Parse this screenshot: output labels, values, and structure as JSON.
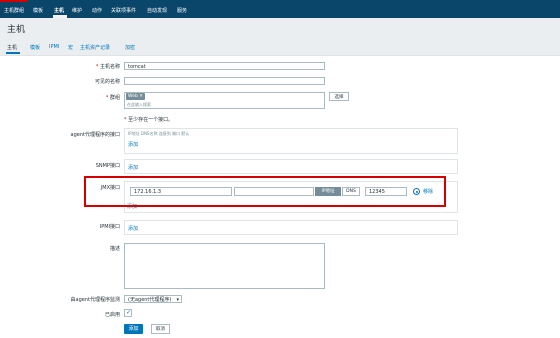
{
  "nav": {
    "items": [
      {
        "label": "主机群组"
      },
      {
        "label": "模板"
      },
      {
        "label": "主机"
      },
      {
        "label": "维护"
      },
      {
        "label": "动作"
      },
      {
        "label": "关联项事件"
      },
      {
        "label": "自动发现"
      },
      {
        "label": "服务"
      }
    ]
  },
  "page": {
    "title": "主机"
  },
  "tabs": [
    {
      "label": "主机"
    },
    {
      "label": "模板"
    },
    {
      "label": "IPMI"
    },
    {
      "label": "宏"
    },
    {
      "label": "主机资产记录"
    },
    {
      "label": "加密"
    }
  ],
  "form": {
    "hostname": {
      "label": "主机名称",
      "value": "tomcat"
    },
    "visible_name": {
      "label": "可见的名称",
      "value": ""
    },
    "groups": {
      "label": "群组",
      "tag": "Web",
      "placeholder": "在此输入搜索",
      "select_label": "选择"
    },
    "interface_note": "至少存在一个接口。",
    "agent": {
      "label": "agent代理程序的接口",
      "hint": "IP地址  DNS名称  连接到  端口  默认",
      "add": "添加"
    },
    "snmp": {
      "label": "SNMP接口",
      "add": "添加"
    },
    "jmx": {
      "label": "JMX接口",
      "ip": "172.16.1.3",
      "dns": "",
      "ip_btn": "IP地址",
      "dns_btn": "DNS",
      "port": "12345",
      "remove": "移除",
      "add": "添加"
    },
    "ipmi": {
      "label": "IPMI接口",
      "add": "添加"
    },
    "description": {
      "label": "描述",
      "value": ""
    },
    "proxy": {
      "label": "由agent代理程序监测",
      "value": "(无agent代理程序)"
    },
    "enabled": {
      "label": "已启用"
    },
    "submit": "添加",
    "cancel": "取消"
  },
  "colors": {
    "topbar": "#0a466a",
    "accent": "#d40000",
    "link": "#0275b8",
    "highlight_box": "#d40000"
  }
}
